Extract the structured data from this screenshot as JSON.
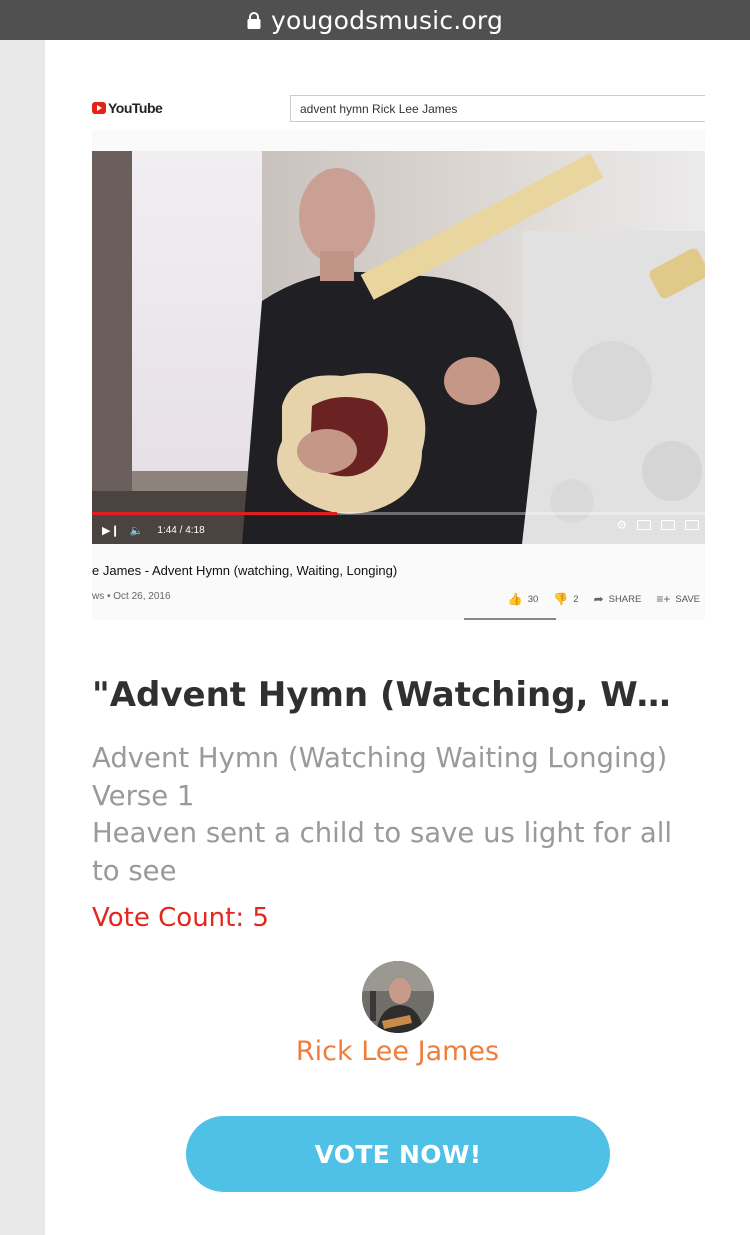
{
  "browser": {
    "url": "yougodsmusic.org"
  },
  "thumbnail": {
    "youtube_logo_text": "YouTube",
    "search_query": "advent hymn Rick Lee James",
    "player": {
      "time": "1:44 / 4:18",
      "progress": 0.4
    },
    "video_title": "e James - Advent Hymn (watching, Waiting, Longing)",
    "video_meta": "ws • Oct 26, 2016",
    "likes": "30",
    "dislikes": "2",
    "share_label": "SHARE",
    "save_label": "SAVE"
  },
  "post": {
    "title": "\"Advent Hymn (Watching, Waiti...",
    "description_lines": [
      "Advent Hymn (Watching Waiting Longing)",
      "Verse 1",
      "Heaven sent a child to save us light for all",
      "to see"
    ],
    "vote_count": "Vote Count: 5"
  },
  "author": {
    "name": "Rick Lee James"
  },
  "vote_button": {
    "label": "VOTE NOW!"
  },
  "colors": {
    "vote_count": "#e3271c",
    "author_name": "#ef7d3e",
    "vote_button": "#4fc0e6",
    "youtube_red": "#e62117"
  },
  "icons": [
    "lock-icon",
    "youtube-play-icon",
    "play-pause-icon",
    "volume-icon",
    "settings-icon",
    "miniplayer-icon",
    "theater-icon",
    "cast-icon",
    "thumbs-up-icon",
    "thumbs-down-icon",
    "share-icon",
    "save-playlist-icon"
  ]
}
